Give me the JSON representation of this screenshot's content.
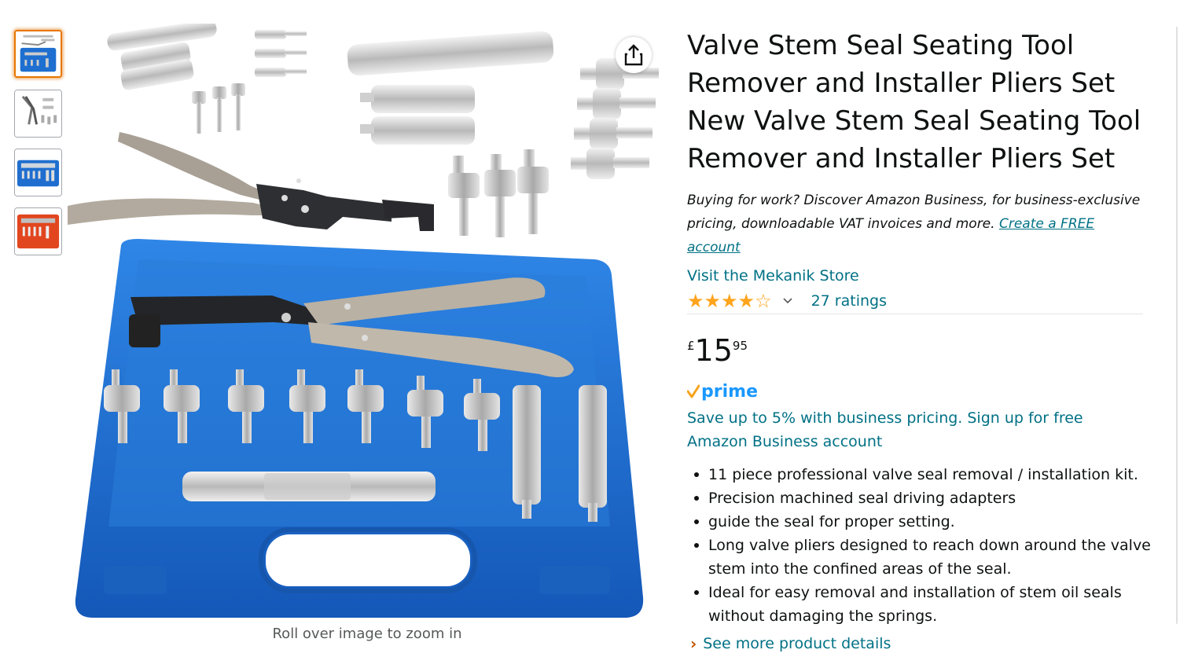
{
  "gallery": {
    "thumbnails": [
      {
        "alt": "Tool kit in blue case with accessories",
        "selected": true
      },
      {
        "alt": "Pliers and adapters",
        "selected": false
      },
      {
        "alt": "Blue case open",
        "selected": false
      },
      {
        "alt": "Orange case",
        "selected": false
      }
    ],
    "zoom_hint": "Roll over image to zoom in"
  },
  "product": {
    "title": "Valve Stem Seal Seating Tool Remover and Installer Pliers Set New Valve Stem Seal Seating Tool Remover and Installer Pliers Set",
    "business_promo_text": "Buying for work? Discover Amazon Business, for business-exclusive pricing, downloadable VAT invoices and more.",
    "business_promo_link": "Create a FREE account",
    "store_link": "Visit the Mekanik Store",
    "rating": {
      "stars": 4.0,
      "max": 5,
      "count_text": "27 ratings"
    },
    "price": {
      "symbol": "£",
      "whole": "15",
      "fraction": "95"
    },
    "prime_label": "prime",
    "business_savings": "Save up to 5% with business pricing. Sign up for free Amazon Business account",
    "bullets": [
      "11 piece professional valve seal removal / installation kit.",
      "Precision machined seal driving adapters",
      "guide the seal for proper setting.",
      "Long valve pliers designed to reach down around the valve stem into the confined areas of the seal.",
      "Ideal for easy removal and installation of stem oil seals without damaging the springs."
    ],
    "see_more": "See more product details"
  },
  "colors": {
    "link": "#007185",
    "star": "#ffa41c",
    "prime": "#1a98ff",
    "case_blue": "#1e6fd0",
    "selected_thumb": "#e77600"
  },
  "icons": {
    "share": "share-icon",
    "rating_dropdown": "chevron-down-icon",
    "see_more": "chevron-right-icon"
  }
}
